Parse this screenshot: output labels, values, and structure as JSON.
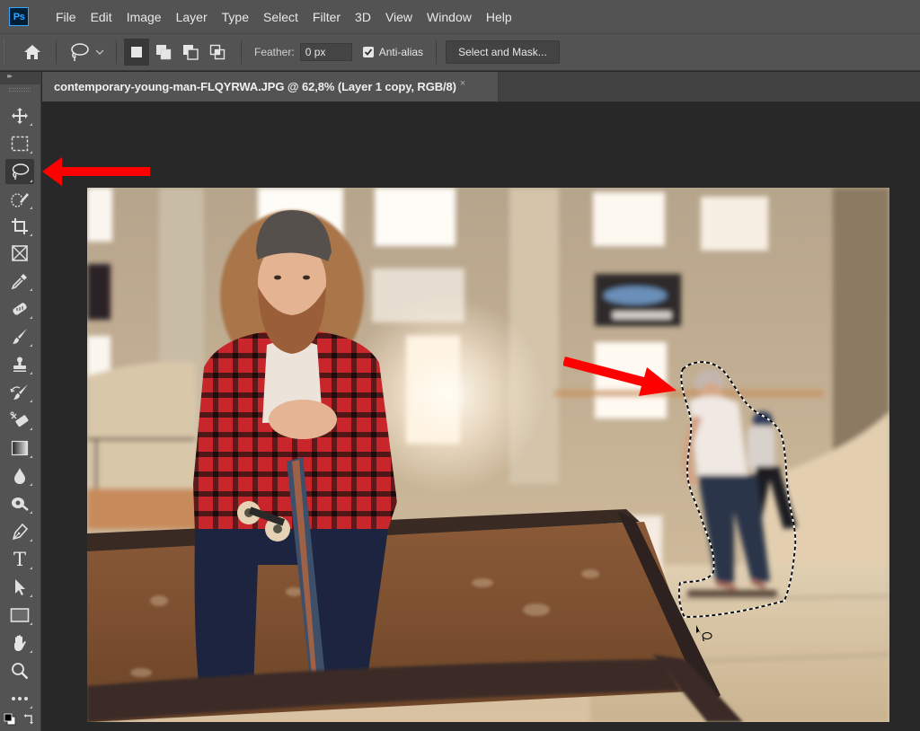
{
  "app": {
    "logo": "Ps",
    "name": "Adobe Photoshop"
  },
  "menu": [
    "File",
    "Edit",
    "Image",
    "Layer",
    "Type",
    "Select",
    "Filter",
    "3D",
    "View",
    "Window",
    "Help"
  ],
  "options_bar": {
    "home_icon": "home-icon",
    "tool_preset_icon": "lasso-icon",
    "selection_modes": [
      {
        "name": "new-selection",
        "active": true
      },
      {
        "name": "add-to-selection",
        "active": false
      },
      {
        "name": "subtract-from-selection",
        "active": false
      },
      {
        "name": "intersect-with-selection",
        "active": false
      }
    ],
    "feather_label": "Feather:",
    "feather_value": "0 px",
    "anti_alias_label": "Anti-alias",
    "anti_alias_checked": true,
    "select_and_mask_label": "Select and Mask..."
  },
  "document": {
    "tab_title": "contemporary-young-man-FLQYRWA.JPG @ 62,8% (Layer 1 copy, RGB/8)",
    "close_glyph": "×",
    "zoom": "62,8%",
    "layer": "Layer 1 copy",
    "mode": "RGB/8"
  },
  "tools": [
    {
      "name": "move-tool",
      "icon": "move-icon"
    },
    {
      "name": "rectangular-marquee-tool",
      "icon": "marquee-icon"
    },
    {
      "name": "lasso-tool",
      "icon": "lasso-icon",
      "active": true
    },
    {
      "name": "quick-selection-tool",
      "icon": "quick-selection-icon"
    },
    {
      "name": "crop-tool",
      "icon": "crop-icon"
    },
    {
      "name": "frame-tool",
      "icon": "frame-icon"
    },
    {
      "name": "eyedropper-tool",
      "icon": "eyedropper-icon"
    },
    {
      "name": "spot-healing-brush-tool",
      "icon": "bandage-icon"
    },
    {
      "name": "brush-tool",
      "icon": "brush-icon"
    },
    {
      "name": "clone-stamp-tool",
      "icon": "stamp-icon"
    },
    {
      "name": "history-brush-tool",
      "icon": "history-brush-icon"
    },
    {
      "name": "eraser-tool",
      "icon": "eraser-icon"
    },
    {
      "name": "gradient-tool",
      "icon": "gradient-icon"
    },
    {
      "name": "blur-tool",
      "icon": "drop-icon"
    },
    {
      "name": "dodge-tool",
      "icon": "dodge-icon"
    },
    {
      "name": "pen-tool",
      "icon": "pen-icon"
    },
    {
      "name": "type-tool",
      "icon": "type-icon"
    },
    {
      "name": "path-selection-tool",
      "icon": "arrow-cursor-icon"
    },
    {
      "name": "rectangle-tool",
      "icon": "rectangle-icon"
    },
    {
      "name": "hand-tool",
      "icon": "hand-icon"
    },
    {
      "name": "zoom-tool",
      "icon": "magnifier-icon"
    },
    {
      "name": "edit-toolbar",
      "icon": "more-icon"
    }
  ],
  "type_tool_glyph": "T",
  "colors": {
    "accent_ps_blue": "#31a8ff",
    "annotation_red": "#ff0000",
    "panel_bg": "#535353",
    "canvas_bg": "#282828"
  },
  "annotations": [
    {
      "type": "arrow",
      "points_to": "lasso-tool"
    },
    {
      "type": "arrow",
      "points_to": "lasso-selection"
    }
  ],
  "canvas": {
    "image_description": "Bearded young man in beanie and red plaid shirt sitting on a skatepark ledge holding a skateboard; blurred skateboarders in background enclosed by a dashed lasso selection",
    "selection": "freeform lasso marching ants around background skaters"
  }
}
